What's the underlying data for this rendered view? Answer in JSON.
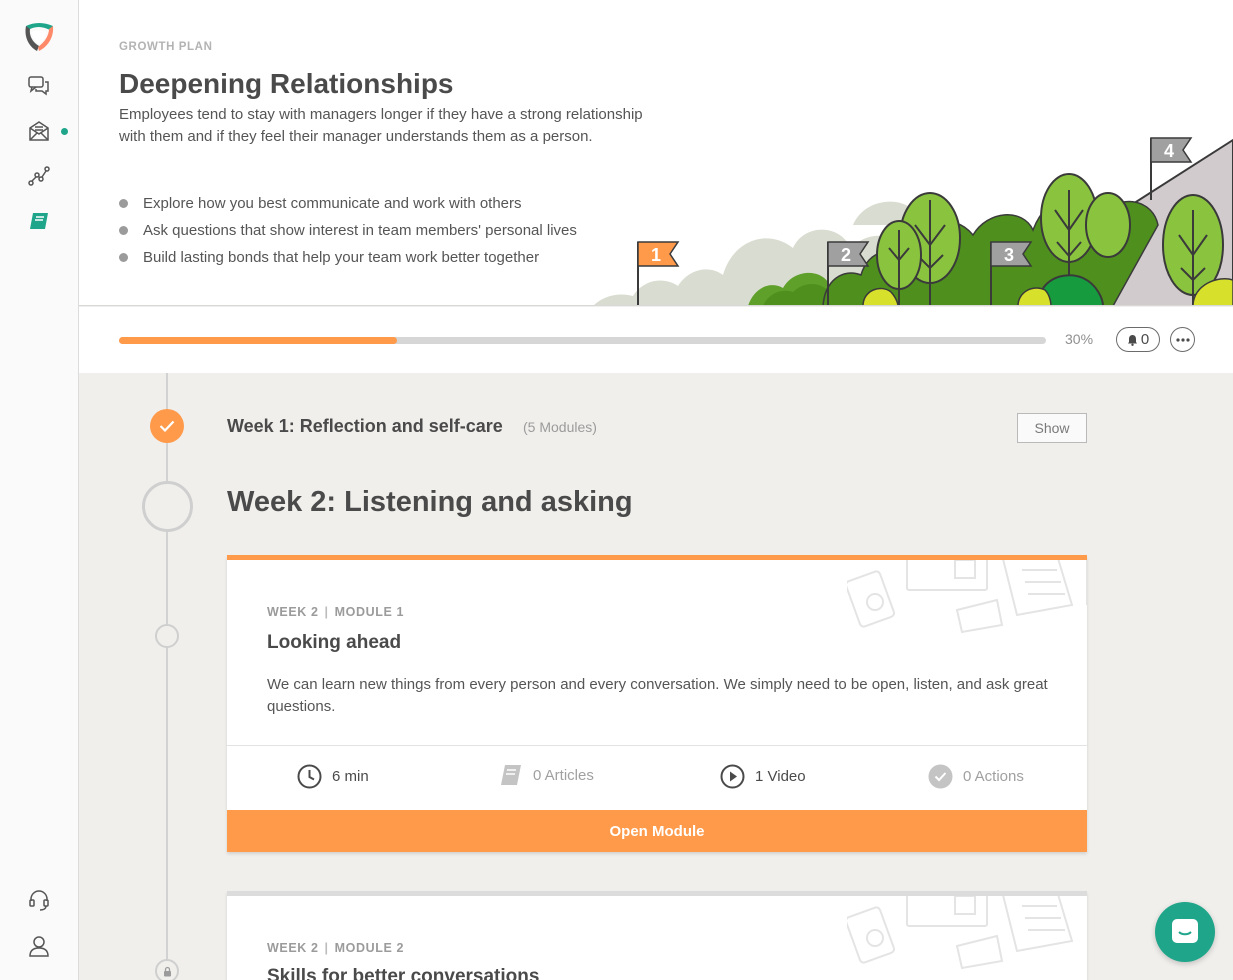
{
  "sidebar": {
    "items": [
      {
        "name": "conversations-icon"
      },
      {
        "name": "inbox-icon",
        "has_notification": true
      },
      {
        "name": "insights-icon"
      },
      {
        "name": "growth-book-icon",
        "active": true
      }
    ],
    "bottom": [
      {
        "name": "support-headset-icon"
      },
      {
        "name": "profile-icon"
      }
    ]
  },
  "header": {
    "eyebrow": "GROWTH PLAN",
    "title": "Deepening Relationships",
    "description": "Employees tend to stay with managers longer if they have a strong relationship with them and if they feel their manager understands them as a person.",
    "bullets": [
      "Explore how you best communicate and work with others",
      "Ask questions that show interest in team members' personal lives",
      "Build lasting bonds that help your team work better together"
    ],
    "flags": [
      "1",
      "2",
      "3",
      "4"
    ]
  },
  "progress": {
    "value": 0.3,
    "label": "30%",
    "notifications": "0"
  },
  "weeks": [
    {
      "title": "Week 1: Reflection and self-care",
      "count": "(5 Modules)",
      "toggle": "Show",
      "completed": true
    },
    {
      "title": "Week 2: Listening and asking"
    }
  ],
  "modules": [
    {
      "week": "WEEK 2",
      "module": "MODULE 1",
      "title": "Looking ahead",
      "description": "We can learn new things from every person and every conversation. We simply need to be open, listen, and ask great questions.",
      "stats": {
        "time": "6 min",
        "articles": "0 Articles",
        "videos": "1 Video",
        "actions": "0 Actions"
      },
      "cta": "Open Module"
    },
    {
      "week": "WEEK 2",
      "module": "MODULE 2",
      "title": "Skills for better conversations",
      "locked": true
    }
  ],
  "colors": {
    "accent": "#ff9a4a",
    "brand": "#1fa58a",
    "text": "#4a4a4a"
  }
}
